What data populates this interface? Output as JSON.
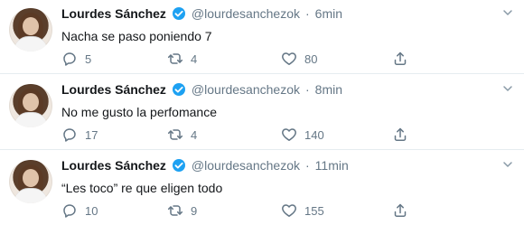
{
  "tweets": [
    {
      "name": "Lourdes Sánchez",
      "handle": "@lourdesanchezok",
      "separator": "·",
      "time": "6min",
      "text": "Nacha se paso poniendo 7",
      "replies": "5",
      "retweets": "4",
      "likes": "80"
    },
    {
      "name": "Lourdes Sánchez",
      "handle": "@lourdesanchezok",
      "separator": "·",
      "time": "8min",
      "text": "No me gusto la perfomance",
      "replies": "17",
      "retweets": "4",
      "likes": "140"
    },
    {
      "name": "Lourdes Sánchez",
      "handle": "@lourdesanchezok",
      "separator": "·",
      "time": "11min",
      "text": "“Les toco” re que eligen todo",
      "replies": "10",
      "retweets": "9",
      "likes": "155"
    }
  ],
  "icons": {
    "verified": "verified-badge-icon",
    "reply": "reply-icon",
    "retweet": "retweet-icon",
    "like": "heart-icon",
    "share": "share-icon",
    "menu": "chevron-down-icon"
  },
  "colors": {
    "text": "#14171a",
    "muted": "#657786",
    "verified": "#1da1f2",
    "divider": "#e6ecf0"
  }
}
